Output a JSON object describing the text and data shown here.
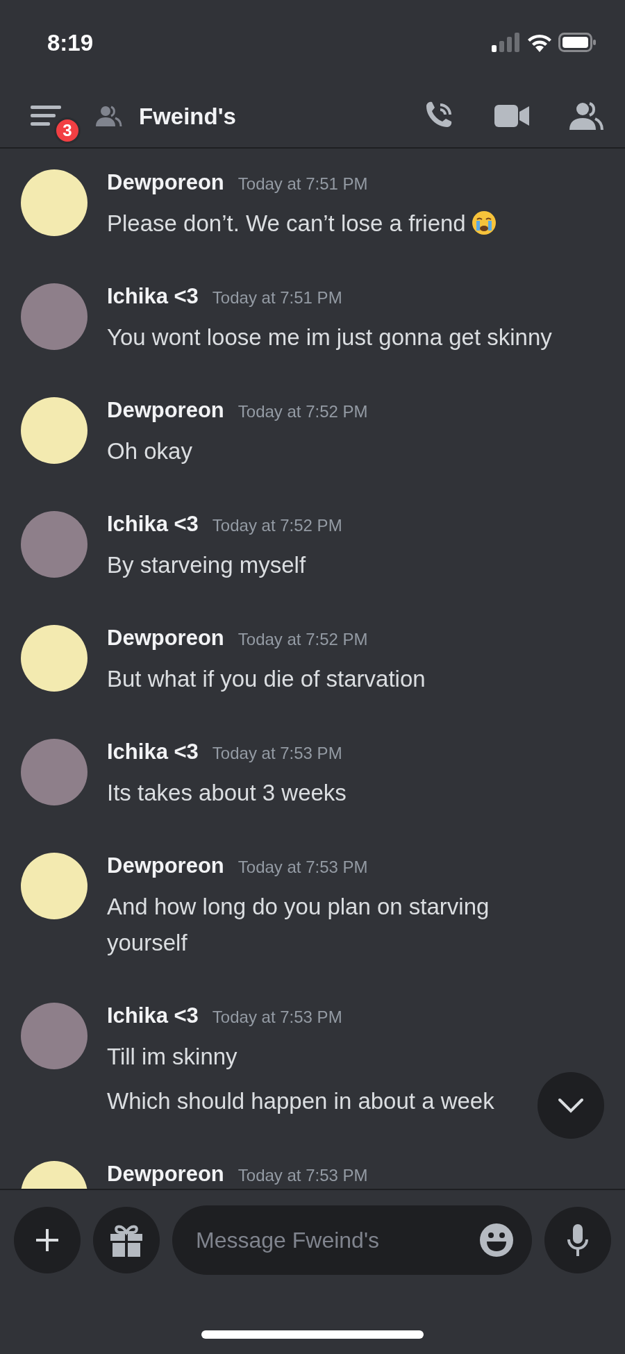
{
  "status_bar": {
    "time": "8:19"
  },
  "header": {
    "badge": "3",
    "title": "Fweind's"
  },
  "messages": [
    {
      "author": "Dewporeon",
      "time": "Today at 7:51 PM",
      "lines": [
        {
          "text": "Please don’t. We can’t lose a friend",
          "emoji": true
        }
      ]
    },
    {
      "author": "Ichika <3",
      "time": "Today at 7:51 PM",
      "lines": [
        {
          "text": "You wont loose me im just gonna get skinny"
        }
      ]
    },
    {
      "author": "Dewporeon",
      "time": "Today at 7:52 PM",
      "lines": [
        {
          "text": "Oh okay"
        }
      ]
    },
    {
      "author": "Ichika <3",
      "time": "Today at 7:52 PM",
      "lines": [
        {
          "text": "By starveing myself"
        }
      ]
    },
    {
      "author": "Dewporeon",
      "time": "Today at 7:52 PM",
      "lines": [
        {
          "text": "But what if you die of starvation"
        }
      ]
    },
    {
      "author": "Ichika <3",
      "time": "Today at 7:53 PM",
      "lines": [
        {
          "text": "Its takes about 3 weeks"
        }
      ]
    },
    {
      "author": "Dewporeon",
      "time": "Today at 7:53 PM",
      "lines": [
        {
          "text": "And how long do you plan on starving yourself"
        }
      ]
    },
    {
      "author": "Ichika <3",
      "time": "Today at 7:53 PM",
      "lines": [
        {
          "text": "Till im skinny"
        },
        {
          "text": "Which should happen in about a week"
        }
      ]
    },
    {
      "author": "Dewporeon",
      "time": "Today at 7:53 PM"
    }
  ],
  "composer": {
    "placeholder": "Message Fweind's"
  }
}
